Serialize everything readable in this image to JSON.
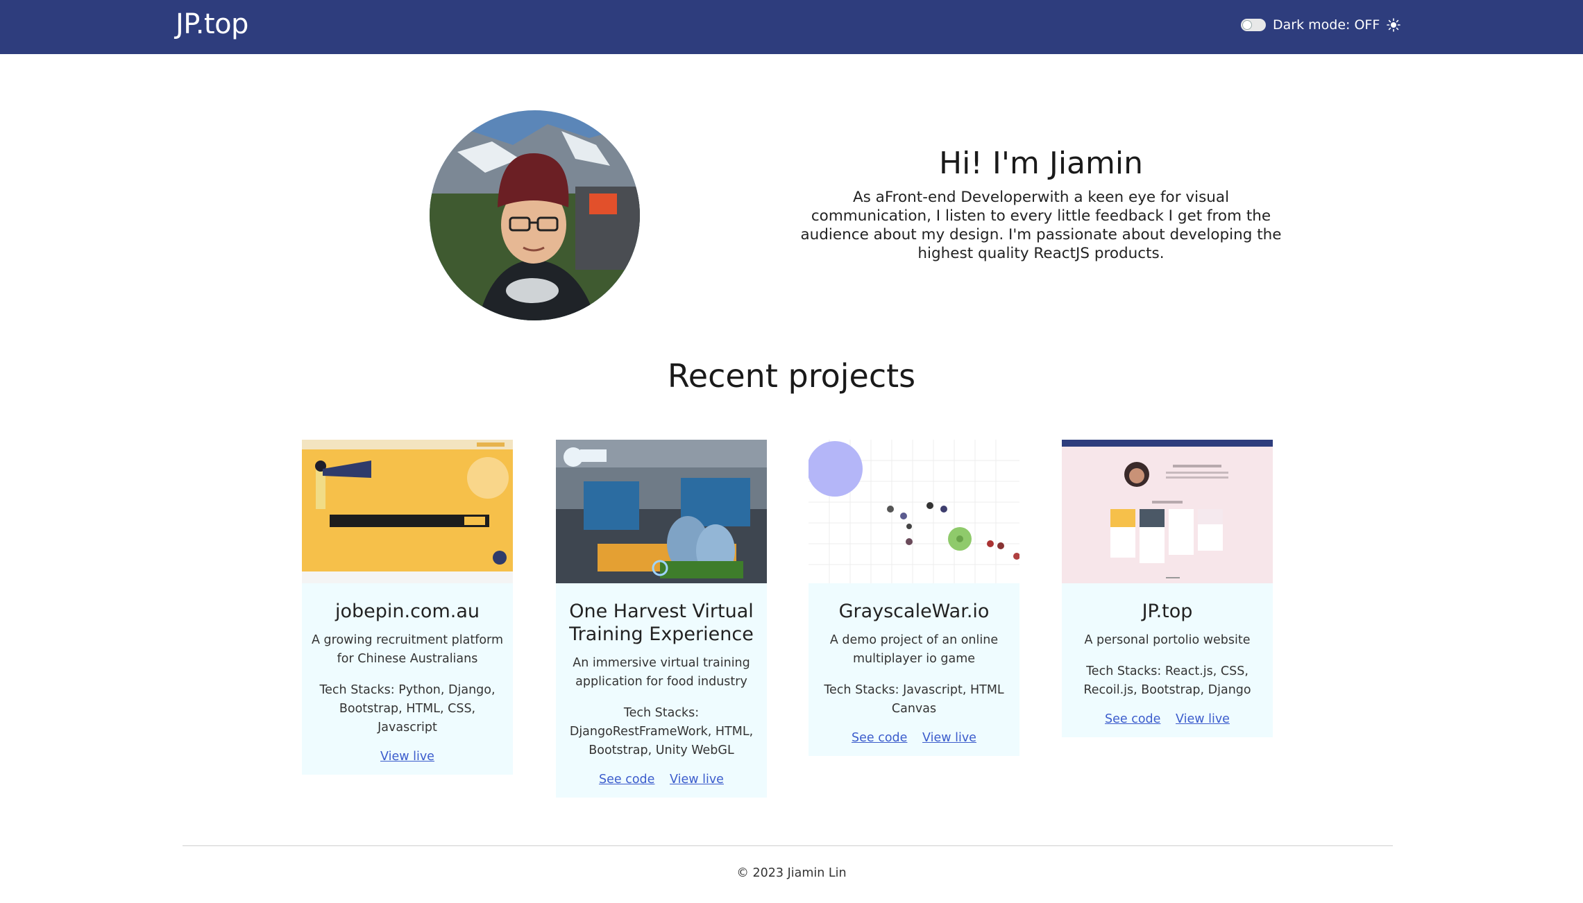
{
  "nav": {
    "brand": "JP.top",
    "dark_mode_label": "Dark mode: OFF",
    "toggle_state": "off",
    "icon": "sun-icon"
  },
  "hero": {
    "title": "Hi! I'm Jiamin",
    "description": "As aFront-end Developerwith a keen eye for visual communication, I listen to every little feedback I get from the audience about my design. I'm passionate about developing the highest quality ReactJS products."
  },
  "projects_section": {
    "title": "Recent projects"
  },
  "projects": [
    {
      "title": "jobepin.com.au",
      "description": "A growing recruitment platform for Chinese Australians",
      "stack": "Tech Stacks: Python, Django, Bootstrap, HTML, CSS, Javascript",
      "links": [
        "View live"
      ]
    },
    {
      "title": "One Harvest Virtual Training Experience",
      "description": "An immersive virtual training application for food industry",
      "stack": "Tech Stacks: DjangoRestFrameWork, HTML, Bootstrap, Unity WebGL",
      "links": [
        "See code",
        "View live"
      ]
    },
    {
      "title": "GrayscaleWar.io",
      "description": "A demo project of an online multiplayer io game",
      "stack": "Tech Stacks: Javascript, HTML Canvas",
      "links": [
        "See code",
        "View live"
      ]
    },
    {
      "title": "JP.top",
      "description": "A personal portolio website",
      "stack": "Tech Stacks: React.js, CSS, Recoil.js, Bootstrap, Django",
      "links": [
        "See code",
        "View live"
      ]
    }
  ],
  "footer": {
    "copyright": "© 2023 Jiamin Lin"
  },
  "colors": {
    "navbar": "#2e3d7d",
    "card_background": "#effcff",
    "link": "#3b5ccc"
  }
}
